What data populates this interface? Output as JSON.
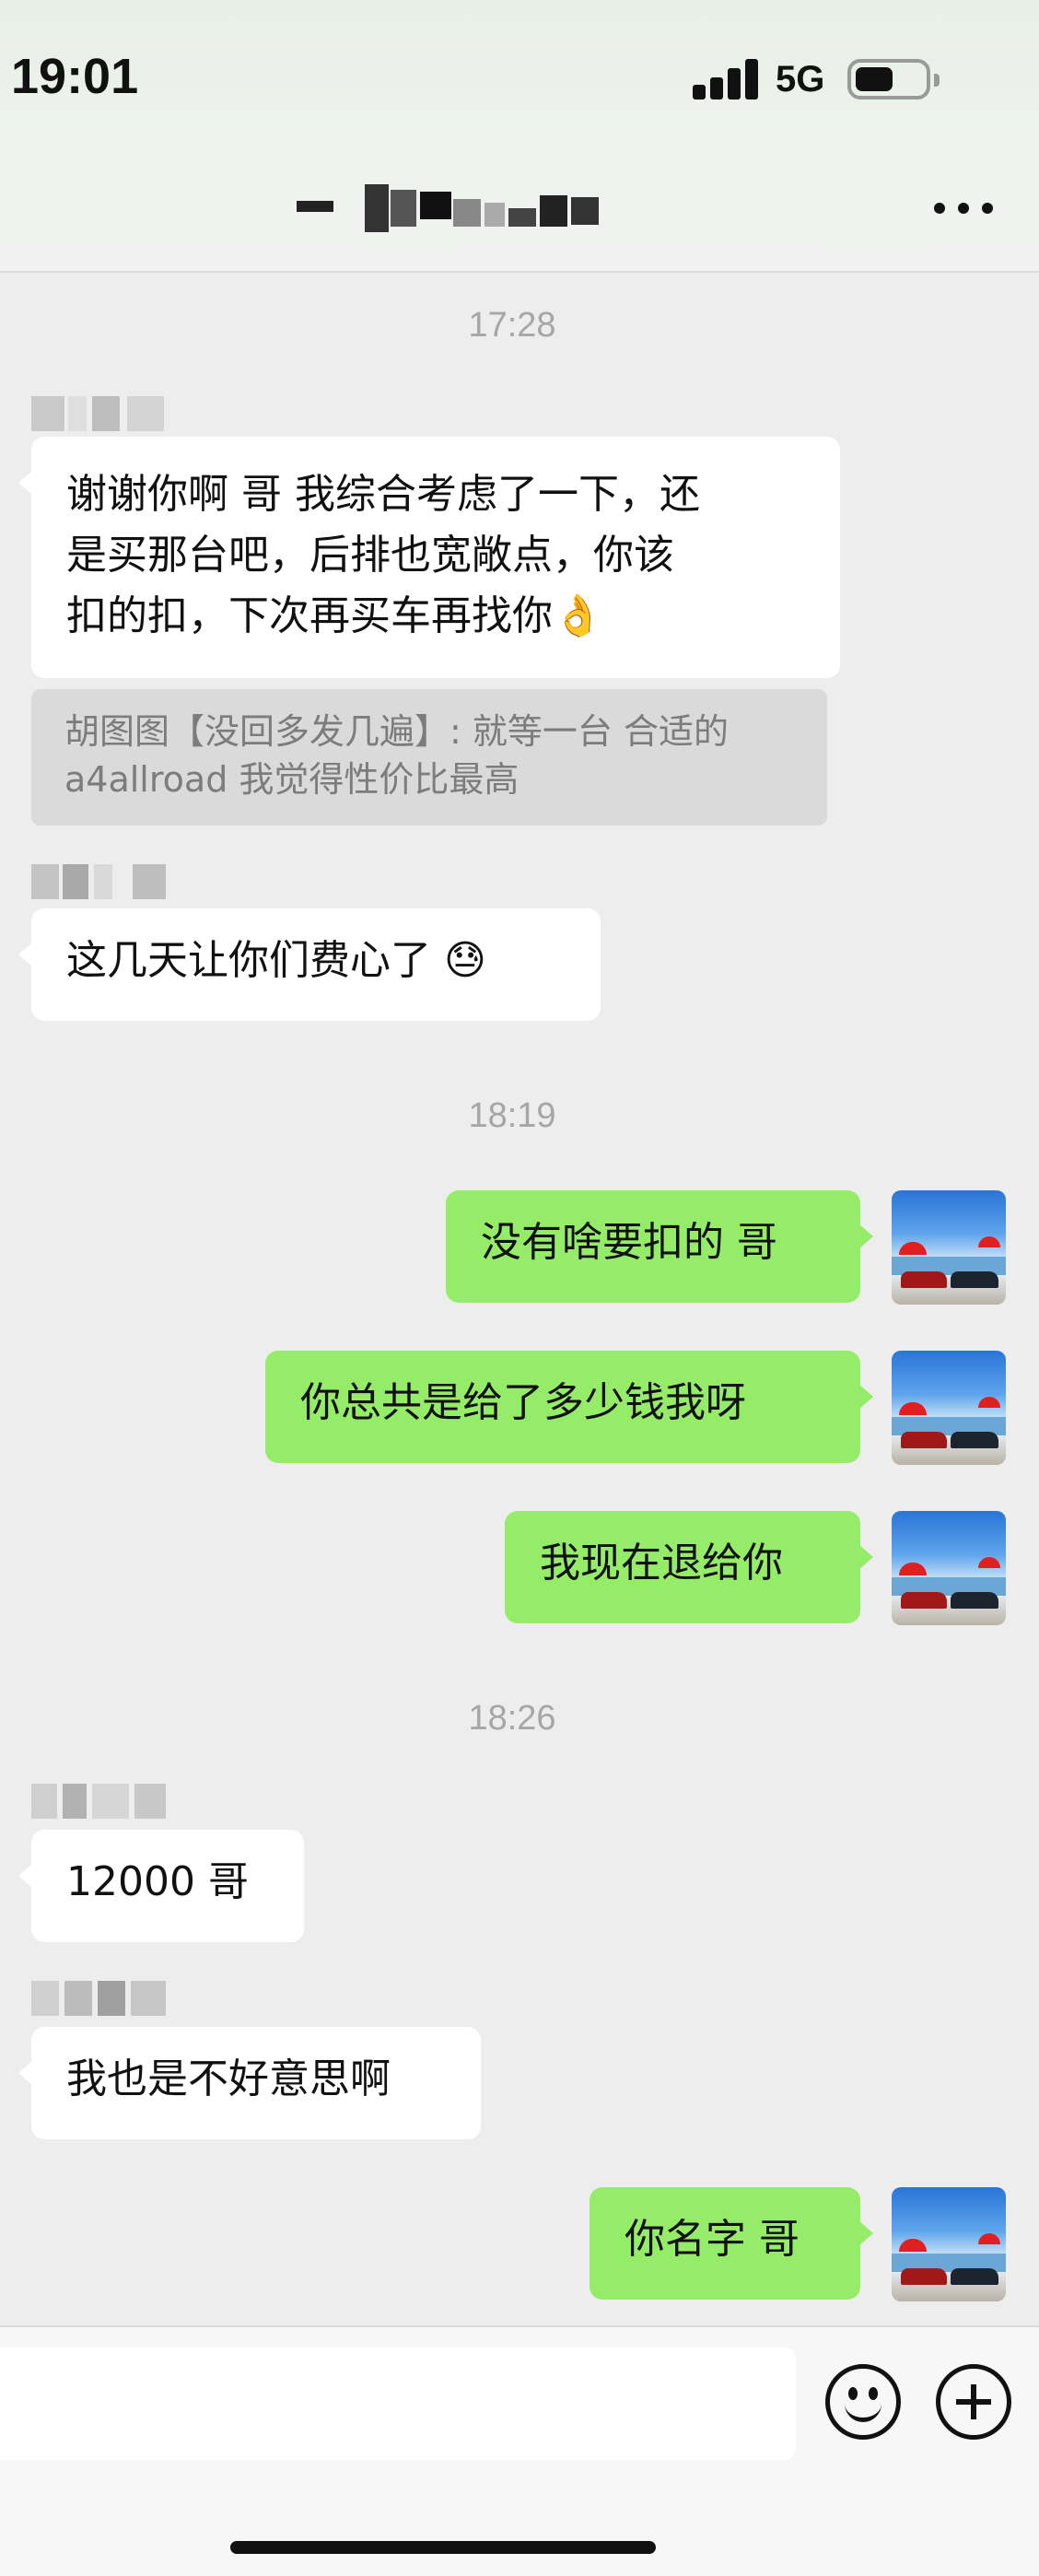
{
  "status_bar": {
    "time": "19:01",
    "network": "5G"
  },
  "header": {
    "more_icon": "more-horizontal-icon"
  },
  "messages": [
    {
      "type": "timestamp",
      "text": "17:28"
    },
    {
      "type": "incoming",
      "text_lines": [
        "谢谢你啊 哥 我综合考虑了一下，还",
        "是买那台吧，后排也宽敞点，你该",
        "扣的扣，下次再买车再找你👌"
      ]
    },
    {
      "type": "quote",
      "lines": [
        "胡图图【没回多发几遍】: 就等一台 合适的",
        "a4allroad 我觉得性价比最高"
      ]
    },
    {
      "type": "incoming",
      "text": "这几天让你们费心了 😓"
    },
    {
      "type": "timestamp",
      "text": "18:19"
    },
    {
      "type": "outgoing",
      "text": "没有啥要扣的 哥"
    },
    {
      "type": "outgoing",
      "text": "你总共是给了多少钱我呀"
    },
    {
      "type": "outgoing",
      "text": "我现在退给你"
    },
    {
      "type": "timestamp",
      "text": "18:26"
    },
    {
      "type": "incoming",
      "text": "12000 哥"
    },
    {
      "type": "incoming",
      "text": "我也是不好意思啊"
    },
    {
      "type": "outgoing",
      "text": "你名字 哥"
    }
  ],
  "input_bar": {
    "emoji_icon": "emoji-smile-icon",
    "plus_icon": "plus-circle-icon"
  },
  "colors": {
    "incoming_bubble": "#ffffff",
    "outgoing_bubble": "#95ec69",
    "chat_bg": "#ededed"
  }
}
